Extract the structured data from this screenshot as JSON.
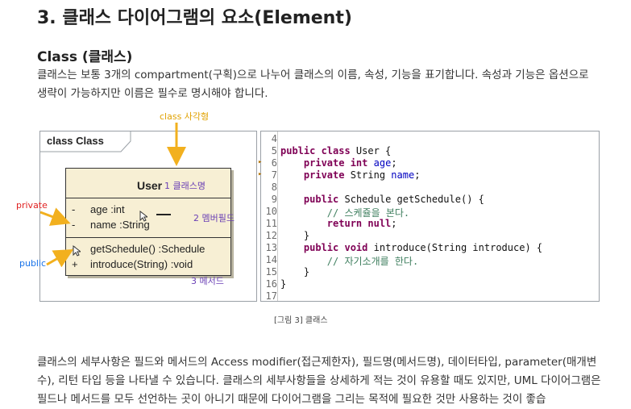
{
  "heading_h3": "3. 클래스 다이어그램의 요소(Element)",
  "heading_h4": "Class (클래스)",
  "para1": "클래스는 보통 3개의 compartment(구획)으로 나누어 클래스의 이름, 속성, 기능을 표기합니다. 속성과 기능은 옵션으로 생략이 가능하지만 이름은 필수로 명시해야 합니다.",
  "diagram": {
    "tab_label": "class Class",
    "class_name": "User",
    "attributes": [
      {
        "vis": "-",
        "text": "age  :int"
      },
      {
        "vis": "-",
        "text": "name  :String"
      }
    ],
    "operations": [
      {
        "vis": "+",
        "text": "getSchedule()  :Schedule"
      },
      {
        "vis": "+",
        "text": "introduce(String)  :void"
      }
    ],
    "annotations": {
      "class_rect": "class 사각형",
      "class_name": "1 클래스명",
      "member_field": "2 멤버필드",
      "method": "3 메서드",
      "private": "private",
      "public": "public"
    },
    "colors": {
      "box_fill": "#f7efd4",
      "arrow": "#f2b01e",
      "red": "#e02020",
      "blue": "#1a73e8",
      "purple": "#6a3fb5"
    }
  },
  "code": {
    "line_numbers": [
      "4",
      "5",
      "6",
      "7",
      "8",
      "9",
      "10",
      "11",
      "12",
      "13",
      "14",
      "15",
      "16",
      "17"
    ],
    "lines": {
      "l5_kw": "public class",
      "l5_rest": " User {",
      "l6_kw": "private int",
      "l6_field": "age",
      "l7_kw": "private",
      "l7_type": " String ",
      "l7_field": "name",
      "l9_kw": "public",
      "l9_rest": " Schedule getSchedule() {",
      "l10_cmt": "// 스케쥴을 본다.",
      "l11_kw": "return null",
      "l12": "}",
      "l13_kw": "public void",
      "l13_rest": " introduce(String introduce) {",
      "l14_cmt": "// 자기소개를 한다.",
      "l15": "}",
      "l16": "}"
    }
  },
  "caption": "[그림 3] 클래스",
  "para2": "클래스의 세부사항은 필드와 메서드의 Access modifier(접근제한자), 필드명(메서드명), 데이터타입, parameter(매개변수), 리턴 타입 등을 나타낼 수 있습니다. 클래스의 세부사항들을 상세하게 적는 것이 유용할 때도 있지만, UML 다이어그램은 필드나 메서드를 모두 선언하는 곳이 아니기 때문에 다이어그램을 그리는 목적에 필요한 것만 사용하는 것이 좋습"
}
